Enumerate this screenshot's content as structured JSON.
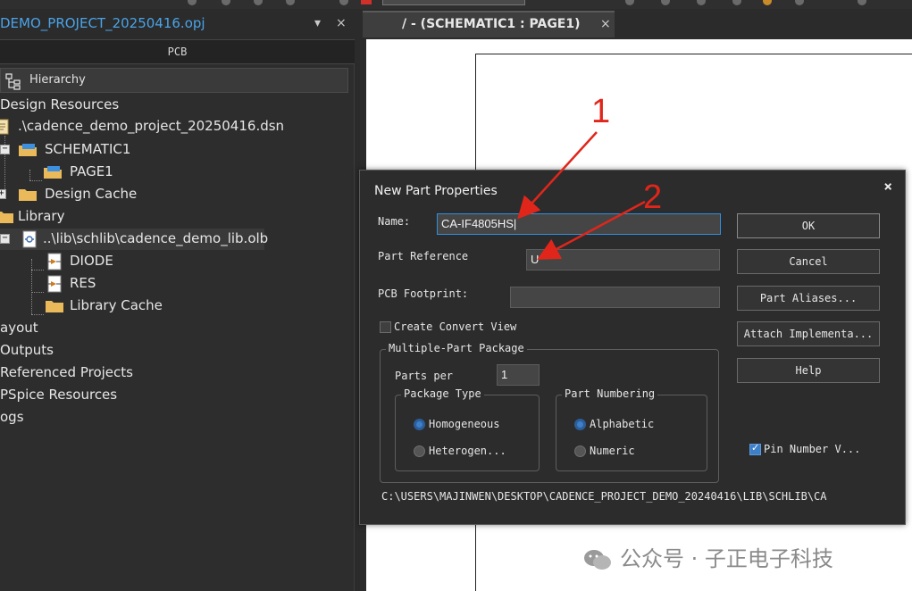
{
  "project_panel": {
    "title": "DEMO_PROJECT_20250416.opj",
    "pin_glyph": "▾",
    "close_glyph": "×",
    "tab": "PCB",
    "hierarchy_label": "Hierarchy"
  },
  "tree": {
    "design_resources": "Design Resources",
    "dsn_file": ".\\cadence_demo_project_20250416.dsn",
    "schematic": "SCHEMATIC1",
    "page": "PAGE1",
    "design_cache": "Design Cache",
    "library": "Library",
    "olb_file": "..\\lib\\schlib\\cadence_demo_lib.olb",
    "diode": "DIODE",
    "res": "RES",
    "library_cache": "Library Cache",
    "layout": "ayout",
    "outputs": "Outputs",
    "referenced_projects": "Referenced Projects",
    "pspice_resources": "PSpice Resources",
    "logs": "ogs"
  },
  "editor_tab": {
    "label": "/ - (SCHEMATIC1 : PAGE1)",
    "close_glyph": "×"
  },
  "dialog": {
    "title": "New Part Properties",
    "close_glyph": "×",
    "name_label": "Name:",
    "name_value": "CA-IF4805HS|",
    "part_reference_label": "Part Reference",
    "part_reference_value": "U",
    "pcb_footprint_label": "PCB Footprint:",
    "pcb_footprint_value": "",
    "create_convert_view_label": "Create Convert View",
    "create_convert_view_checked": false,
    "multiple_part_package_label": "Multiple-Part Package",
    "parts_per_label": "Parts per",
    "parts_per_value": "1",
    "package_type_label": "Package Type",
    "homogeneous_label": "Homogeneous",
    "heterogeneous_label": "Heterogen...",
    "package_type_selected": "Homogeneous",
    "part_numbering_label": "Part Numbering",
    "alphabetic_label": "Alphabetic",
    "numeric_label": "Numeric",
    "part_numbering_selected": "Alphabetic",
    "pin_number_visible_label": "Pin Number V...",
    "pin_number_visible_checked": true,
    "buttons": {
      "ok": "OK",
      "cancel": "Cancel",
      "part_aliases": "Part Aliases...",
      "attach_implementation": "Attach Implementa...",
      "help": "Help"
    },
    "library_path": "C:\\USERS\\MAJINWEN\\DESKTOP\\CADENCE_PROJECT_DEMO_20240416\\LIB\\SCHLIB\\CA"
  },
  "annotations": {
    "arrow1_number": "1",
    "arrow2_number": "2",
    "color": "#e0261b"
  },
  "watermark": {
    "text": "公众号 · 子正电子科技"
  },
  "colors": {
    "accent": "#4aa3e8",
    "focus_border": "#2f8fe0",
    "radio_selected": "#3d7fc9",
    "folder": "#e9b95a"
  }
}
